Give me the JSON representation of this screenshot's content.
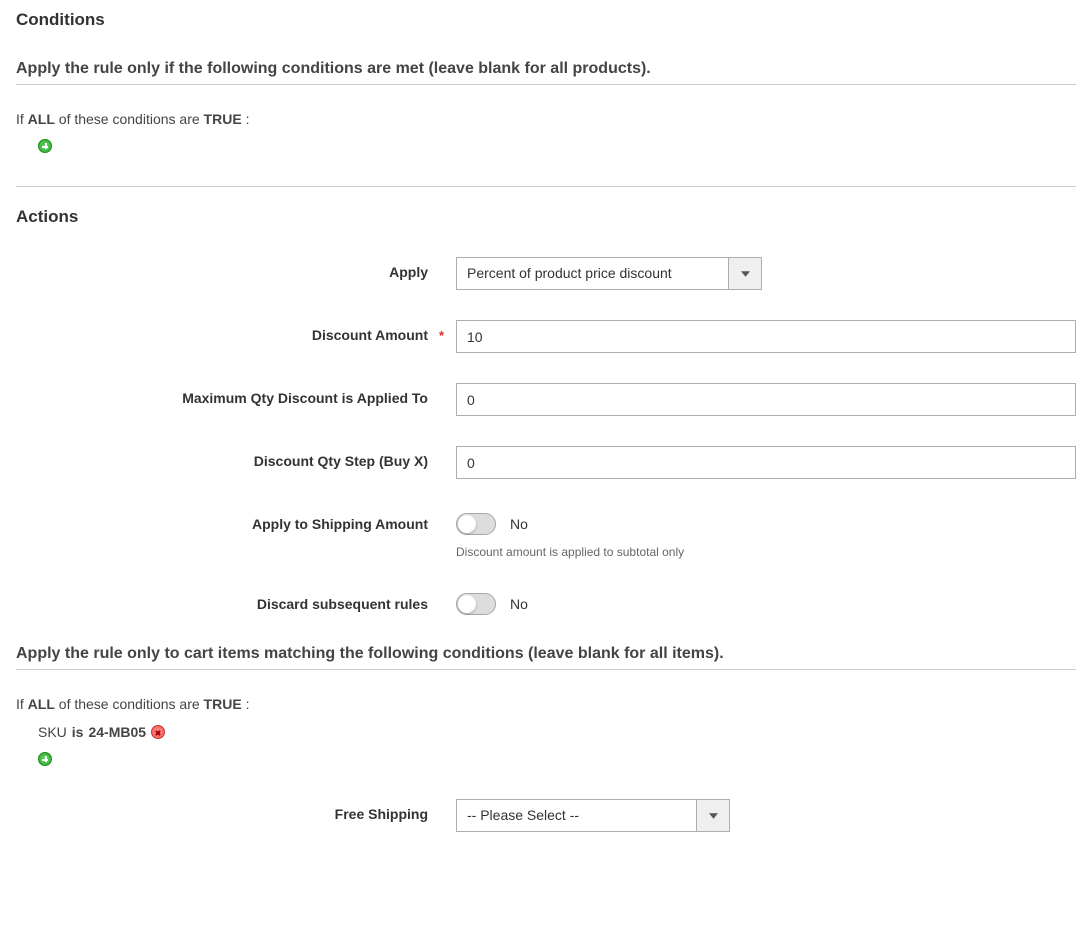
{
  "sections": {
    "conditions_title": "Conditions",
    "actions_title": "Actions"
  },
  "conditions": {
    "fieldset_title": "Apply the rule only if the following conditions are met (leave blank for all products).",
    "line_prefix": "If",
    "aggregate": "ALL",
    "line_mid": "of these conditions are",
    "truth": "TRUE",
    "line_suffix": ":"
  },
  "actions_form": {
    "apply": {
      "label": "Apply",
      "value": "Percent of product price discount"
    },
    "discount_amount": {
      "label": "Discount Amount",
      "value": "10"
    },
    "max_qty": {
      "label": "Maximum Qty Discount is Applied To",
      "value": "0"
    },
    "qty_step": {
      "label": "Discount Qty Step (Buy X)",
      "value": "0"
    },
    "apply_shipping": {
      "label": "Apply to Shipping Amount",
      "value_label": "No",
      "help": "Discount amount is applied to subtotal only"
    },
    "discard": {
      "label": "Discard subsequent rules",
      "value_label": "No"
    },
    "free_shipping": {
      "label": "Free Shipping",
      "value": "-- Please Select --"
    }
  },
  "cart_conditions": {
    "fieldset_title": "Apply the rule only to cart items matching the following conditions (leave blank for all items).",
    "line_prefix": "If",
    "aggregate": "ALL",
    "line_mid": "of these conditions are",
    "truth": "TRUE",
    "line_suffix": ":",
    "item": {
      "attribute": "SKU",
      "operator": "is",
      "value": "24-MB05"
    }
  }
}
